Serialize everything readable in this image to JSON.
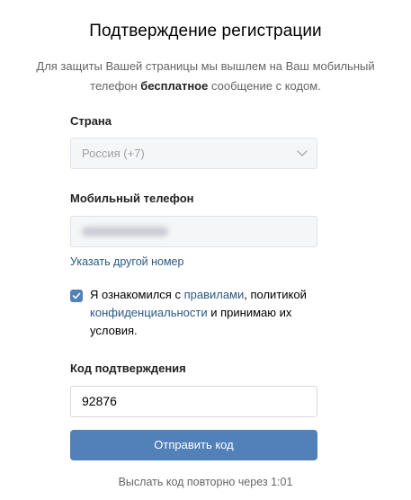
{
  "header": {
    "title": "Подтверждение регистрации",
    "subtitle_line1": "Для защиты Вашей страницы мы вышлем на Ваш мобильный",
    "subtitle_line2_pre": "телефон ",
    "subtitle_line2_bold": "бесплатное",
    "subtitle_line2_post": " сообщение с кодом."
  },
  "country": {
    "label": "Страна",
    "value": "Россия (+7)"
  },
  "phone": {
    "label": "Мобильный телефон",
    "change_link": "Указать другой номер"
  },
  "terms": {
    "checked": true,
    "text_1": "Я ознакомился с ",
    "link_rules": "правилами",
    "text_2": ", политикой ",
    "link_privacy": "конфиденциальности",
    "text_3": " и принимаю их условия."
  },
  "code": {
    "label": "Код подтверждения",
    "value": "92876"
  },
  "submit": {
    "label": "Отправить код"
  },
  "resend": {
    "text": "Выслать код повторно через 1:01"
  },
  "colors": {
    "accent": "#5181b8",
    "link": "#2a5885"
  }
}
